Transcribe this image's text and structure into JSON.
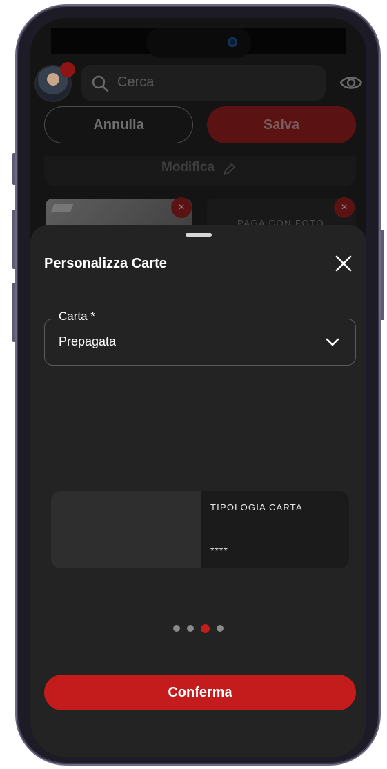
{
  "header": {
    "search_placeholder": "Cerca",
    "icons": [
      "avatar",
      "search-icon",
      "eye-icon"
    ]
  },
  "actions": {
    "cancel_label": "Annulla",
    "save_label": "Salva"
  },
  "background": {
    "modifica_label": "Modifica",
    "cards": [
      {
        "label": "",
        "remove_symbol": "×"
      },
      {
        "label": "PAGA CON FOTO",
        "remove_symbol": "×"
      }
    ]
  },
  "sheet": {
    "title": "Personalizza Carte",
    "select": {
      "label": "Carta *",
      "value": "Prepagata"
    },
    "card_preview": {
      "type_label": "TIPOLOGIA CARTA",
      "masked_number": "****"
    },
    "pagination": {
      "total": 4,
      "active_index": 2
    },
    "confirm_label": "Conferma"
  },
  "colors": {
    "accent_red": "#c41c1c",
    "sheet_background": "#232323",
    "screen_background": "#141414"
  }
}
